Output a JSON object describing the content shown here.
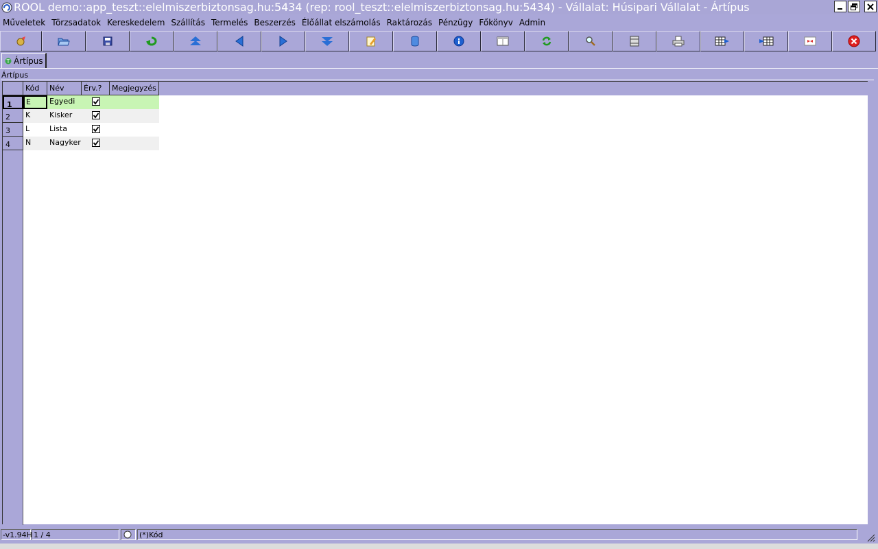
{
  "window": {
    "title": "ROOL demo::app_teszt::elelmiszerbiztonsag.hu:5434 (rep: rool_teszt::elelmiszerbiztonsag.hu:5434) - Vállalat: Húsipari Vállalat - Ártípus"
  },
  "menu": {
    "items": [
      "Műveletek",
      "Törzsadatok",
      "Kereskedelem",
      "Szállítás",
      "Termelés",
      "Beszerzés",
      "Élőállat elszámolás",
      "Raktározás",
      "Pénzügy",
      "Főkönyv",
      "Admin"
    ]
  },
  "toolbar": {
    "icons": [
      "actions-icon",
      "open-folder-icon",
      "save-icon",
      "undo-icon",
      "first-record-icon",
      "previous-record-icon",
      "next-record-icon",
      "last-record-icon",
      "edit-icon",
      "database-icon",
      "info-icon",
      "form-view-icon",
      "refresh-icon",
      "search-icon",
      "columns-icon",
      "print-icon",
      "table-export-icon",
      "table-import-icon",
      "layout-icon",
      "close-icon"
    ]
  },
  "tab": {
    "label": "Ártípus"
  },
  "panel": {
    "label": "Ártípus"
  },
  "grid": {
    "columns": [
      "Kód",
      "Név",
      "Érv.?",
      "Megjegyzés"
    ],
    "rows": [
      {
        "num": "1",
        "kod": "E",
        "nev": "Egyedi",
        "erv": true,
        "megjegyzes": ""
      },
      {
        "num": "2",
        "kod": "K",
        "nev": "Kisker",
        "erv": true,
        "megjegyzes": ""
      },
      {
        "num": "3",
        "kod": "L",
        "nev": "Lista",
        "erv": true,
        "megjegyzes": ""
      },
      {
        "num": "4",
        "kod": "N",
        "nev": "Nagyker",
        "erv": true,
        "megjegyzes": ""
      }
    ]
  },
  "status": {
    "version": "-v1.94H",
    "record_position": "1 / 4",
    "sort_field": "(*)Kód"
  },
  "colors": {
    "chrome": "#aaa7d8",
    "selected_row": "#c8f5b4",
    "alt_row": "#f0f0f0"
  }
}
